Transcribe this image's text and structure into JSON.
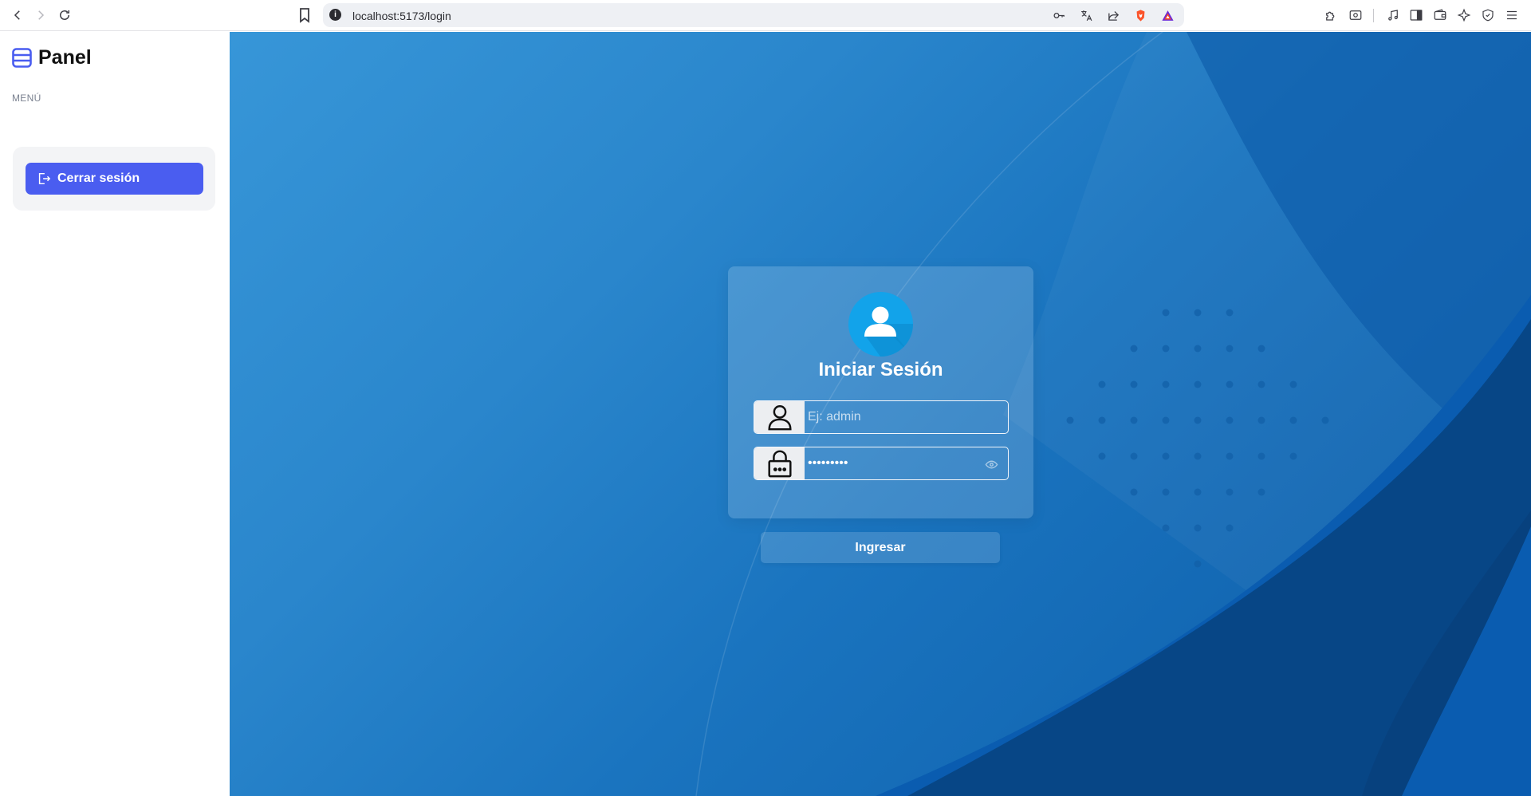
{
  "browser": {
    "url": "localhost:5173/login",
    "icons": [
      "back-icon",
      "forward-icon",
      "reload-icon",
      "bookmark-icon",
      "site-info-icon",
      "key-icon",
      "translate-icon",
      "share-icon",
      "brave-shield-icon",
      "brave-rewards-icon",
      "extensions-icon",
      "screenshot-icon",
      "media-icon",
      "sidebar-icon",
      "wallet-icon",
      "leo-ai-icon",
      "vpn-icon",
      "menu-icon"
    ]
  },
  "sidebar": {
    "brand": "Panel",
    "menu_label": "MENÚ",
    "logout_label": "Cerrar sesión"
  },
  "login": {
    "title": "Iniciar Sesión",
    "username": {
      "value": "",
      "placeholder": "Ej: admin"
    },
    "password": {
      "value": "•••••••••",
      "placeholder": ""
    },
    "submit_label": "Ingresar"
  },
  "colors": {
    "accent": "#4a5df0",
    "avatar": "#12a3ea",
    "background_light": "#3796d8",
    "background_dark": "#0c5ca8"
  }
}
